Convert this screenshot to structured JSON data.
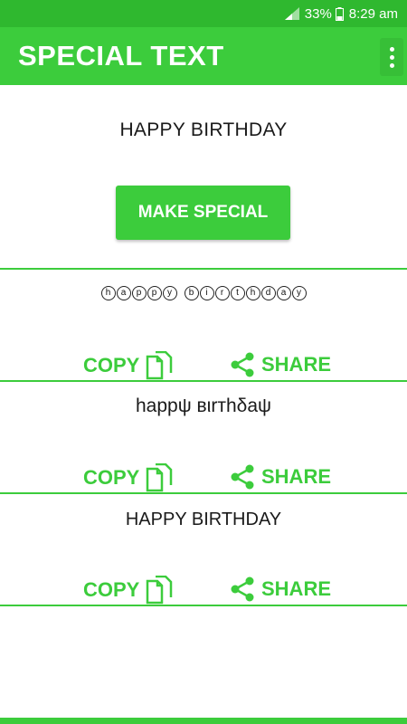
{
  "status_bar": {
    "battery_percent": "33%",
    "time": "8:29 am"
  },
  "app_bar": {
    "title": "SPECIAL TEXT",
    "menu_icon": "more-vert-icon"
  },
  "input_text": "HAPPY BIRTHDAY",
  "make_special_label": "MAKE SPECIAL",
  "results": [
    {
      "style": "circled",
      "text": "happy birthday",
      "copy_label": "COPY",
      "share_label": "SHARE"
    },
    {
      "style": "greek-like",
      "text": "happψ вιrтhδaψ",
      "copy_label": "COPY",
      "share_label": "SHARE"
    },
    {
      "style": "caps",
      "text": "HAPPY BIRTHDAY",
      "copy_label": "COPY",
      "share_label": "SHARE"
    }
  ],
  "colors": {
    "accent": "#3ccc3c",
    "status_bar": "#2fb82f",
    "text": "#1a1a1a"
  }
}
